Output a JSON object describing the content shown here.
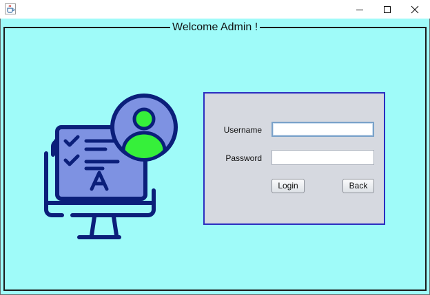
{
  "window": {
    "app_icon": "java-cup-icon",
    "controls": {
      "minimize_icon": "minimize-icon",
      "maximize_icon": "maximize-icon",
      "close_icon": "close-icon"
    }
  },
  "panel": {
    "border_title": "Welcome Admin !",
    "background_color": "#9ffbf9",
    "illustration_icon": "admin-monitor-illustration"
  },
  "login": {
    "username_label": "Username",
    "username_value": "",
    "password_label": "Password",
    "password_value": "",
    "login_button": "Login",
    "back_button": "Back",
    "panel_color": "#d6d9e0",
    "panel_border_color": "#2a2ec0"
  }
}
